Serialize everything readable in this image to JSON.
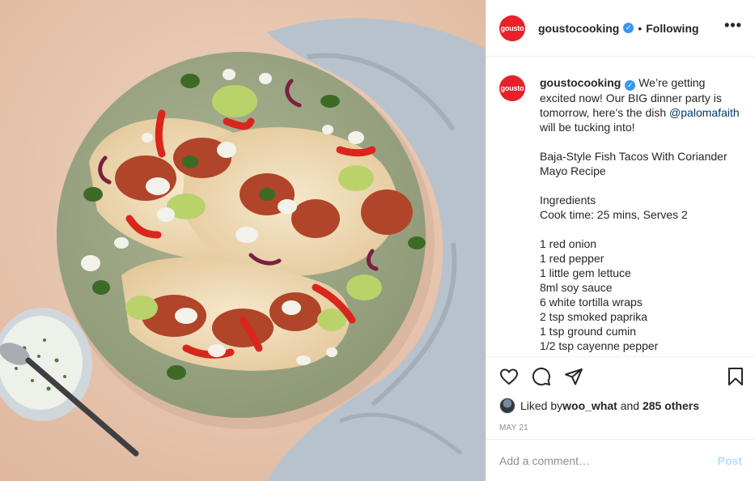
{
  "post": {
    "username": "goustocooking",
    "avatar_text": "gousto",
    "verified_badge": "✓",
    "follow_status": "Following",
    "more_icon": "more-options-icon",
    "caption": {
      "username": "goustocooking",
      "text_1": " We’re getting excited now! Our BIG dinner party is tomorrow, here’s the dish ",
      "mention": "@palomafaith",
      "text_2": " will be tucking into!\n\nBaja-Style Fish Tacos With Coriander Mayo Recipe\n\nIngredients\nCook time: 25 mins, Serves 2\n\n1 red onion\n1 red pepper\n1 little gem lettuce\n8ml soy sauce\n6 white tortilla wraps\n2 tsp smoked paprika\n1 tsp ground cumin\n1/2 tsp cayenne pepper"
    },
    "likes": {
      "prefix": "Liked by ",
      "user": "woo_what",
      "middle": " and ",
      "others": "285 others"
    },
    "date": "MAY 21",
    "comment_placeholder": "Add a comment…",
    "post_button": "Post"
  },
  "colors": {
    "brand": "#e8202a",
    "verified": "#3897f0",
    "mention": "#00376b",
    "post_disabled": "#b2dffc",
    "photo_background": "#e9c9b4"
  },
  "icons": [
    "heart-icon",
    "comment-icon",
    "share-icon",
    "bookmark-icon"
  ]
}
